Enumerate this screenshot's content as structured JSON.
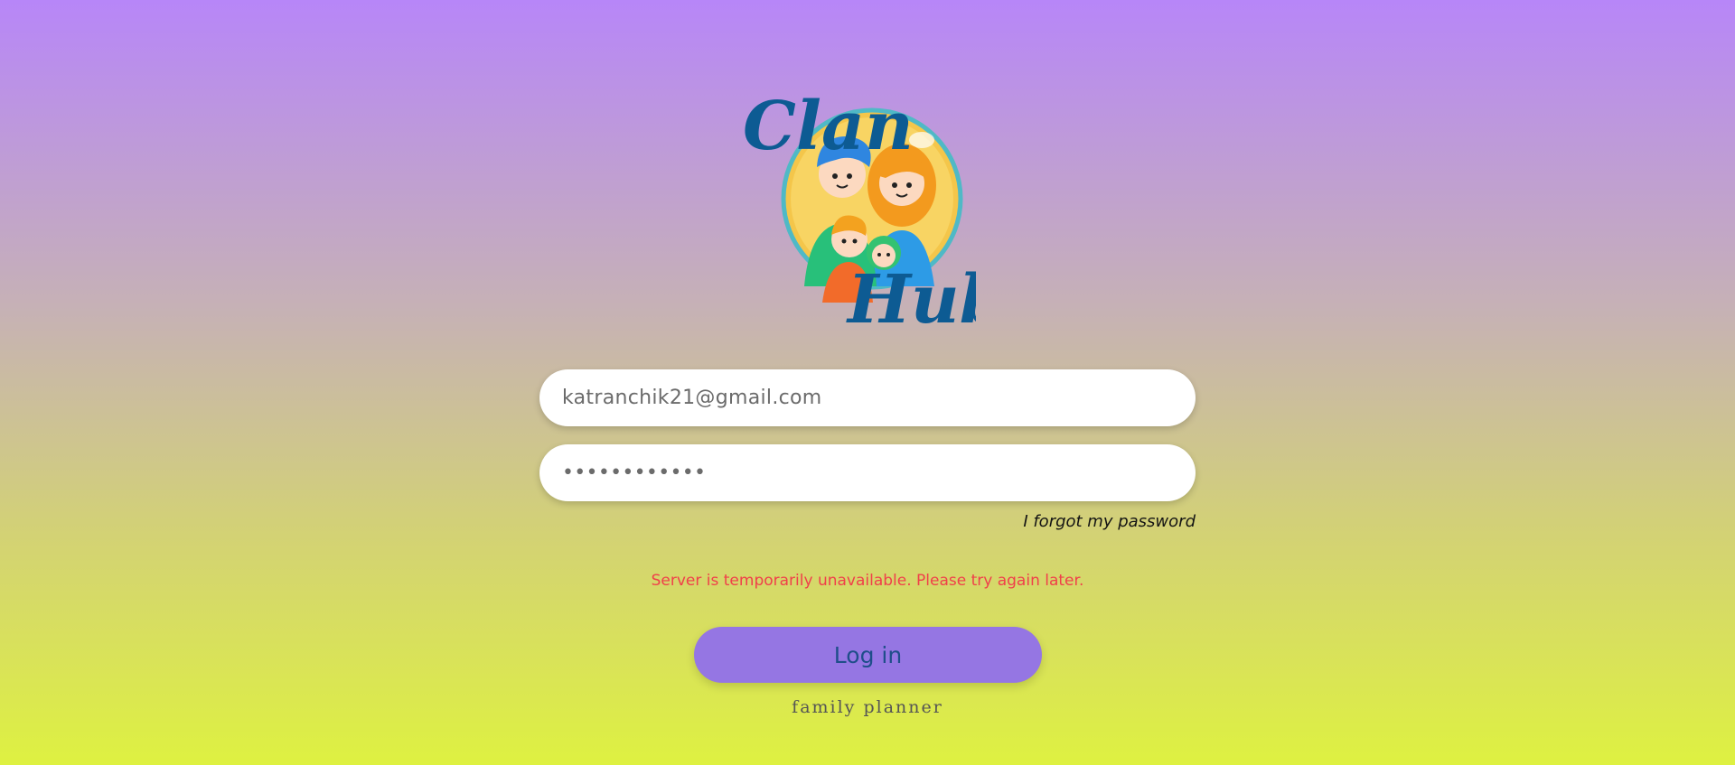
{
  "logo": {
    "word_top": "Clan",
    "word_bottom": "Hub",
    "icon": "family-icon",
    "brand_color": "#0d5b93"
  },
  "login_form": {
    "email_value": "katranchik21@gmail.com",
    "password_value": "••••••••••••",
    "forgot_link": "I forgot my password",
    "error_message": "Server is temporarily unavailable. Please try again later.",
    "submit_label": "Log in"
  },
  "footer": {
    "tagline": "family planner"
  },
  "colors": {
    "gradient_top": "#b786f8",
    "gradient_bottom": "#def141",
    "button": "#9576e3",
    "error": "#f0404a"
  }
}
